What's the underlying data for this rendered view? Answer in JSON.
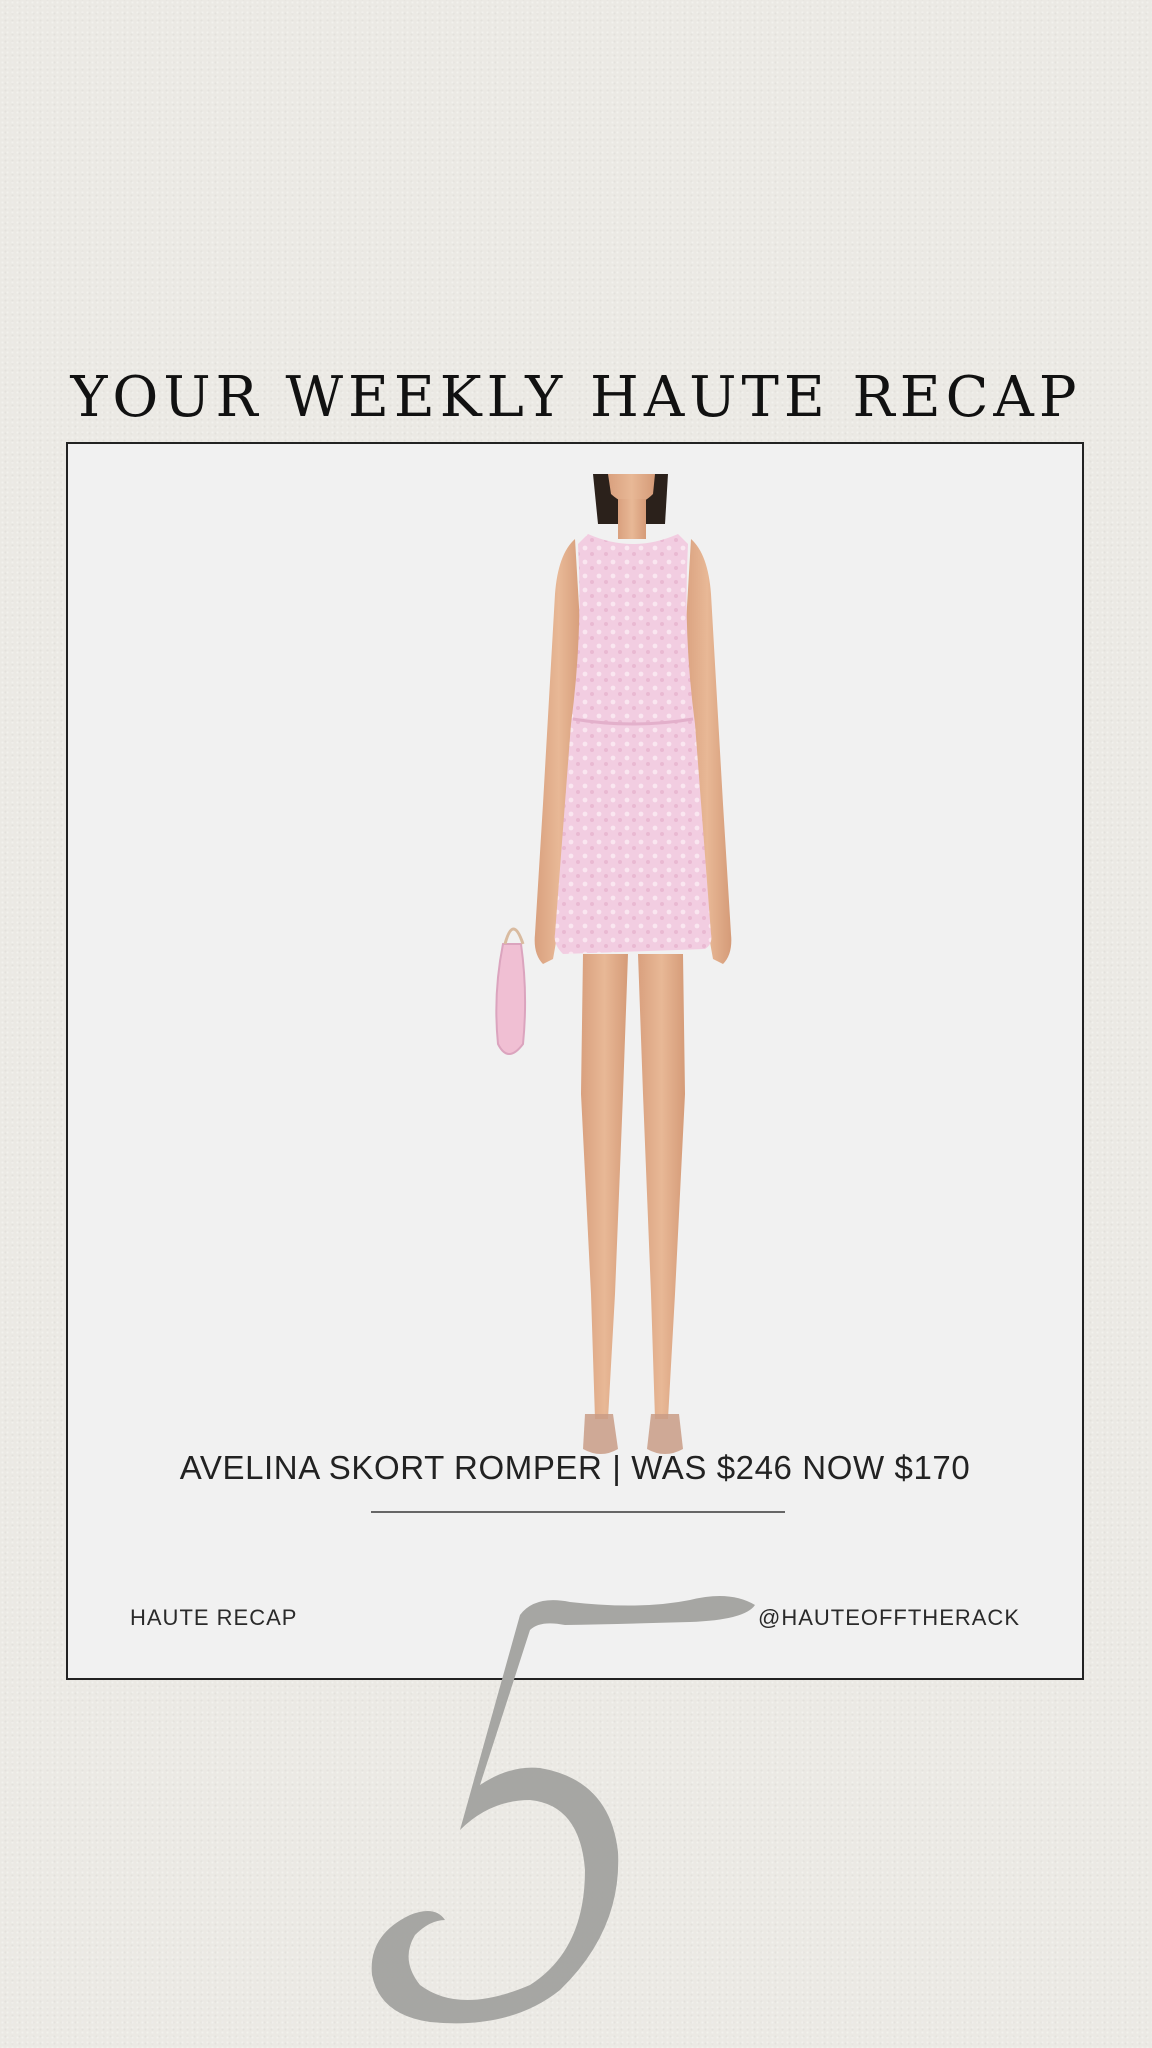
{
  "header": {
    "title": "YOUR WEEKLY HAUTE RECAP"
  },
  "card": {
    "product_caption": "AVELINA SKORT ROMPER | WAS $246 NOW $170",
    "footer_left": "HAUTE RECAP",
    "footer_right": "@HAUTEOFFTHERACK"
  },
  "page_number": "5",
  "colors": {
    "background": "#ebe9e4",
    "card": "#f1f1f1",
    "border": "#222222",
    "page_number": "#a6a6a3",
    "dress": "#f1cde0"
  }
}
